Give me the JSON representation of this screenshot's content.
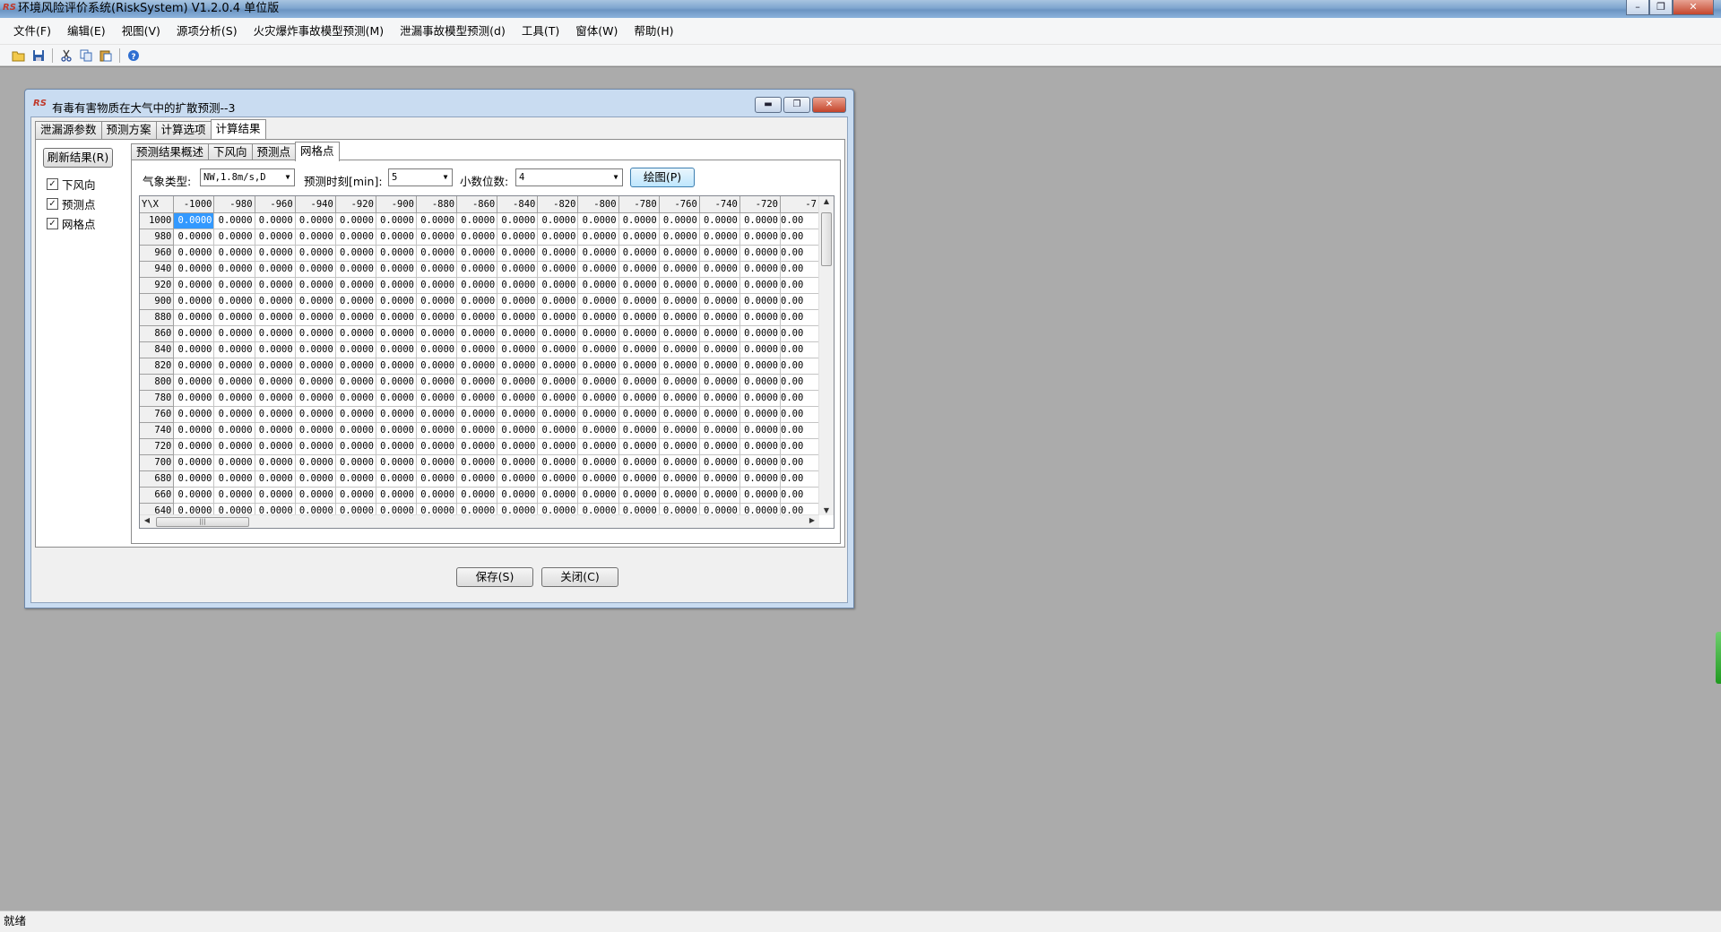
{
  "app": {
    "title": "环境风险评价系统(RiskSystem) V1.2.0.4 单位版",
    "status": "就绪"
  },
  "menu": [
    "文件(F)",
    "编辑(E)",
    "视图(V)",
    "源项分析(S)",
    "火灾爆炸事故模型预测(M)",
    "泄漏事故模型预测(d)",
    "工具(T)",
    "窗体(W)",
    "帮助(H)"
  ],
  "toolbar": {
    "icons": [
      "open-folder-icon",
      "save-icon",
      "cut-icon",
      "copy-icon",
      "paste-icon",
      "help-icon"
    ]
  },
  "dialog": {
    "title": "有毒有害物质在大气中的扩散预测--3",
    "outer_tabs": [
      "泄漏源参数",
      "预测方案",
      "计算选项",
      "计算结果"
    ],
    "active_outer_tab": 3,
    "refresh_button": "刷新结果(R)",
    "checkboxes": [
      {
        "label": "下风向",
        "checked": true
      },
      {
        "label": "预测点",
        "checked": true
      },
      {
        "label": "网格点",
        "checked": true
      }
    ],
    "inner_tabs": [
      "预测结果概述",
      "下风向",
      "预测点",
      "网格点"
    ],
    "active_inner_tab": 3,
    "controls": {
      "weather_label": "气象类型:",
      "weather_value": "NW,1.8m/s,D",
      "time_label": "预测时刻[min]:",
      "time_value": "5",
      "decimal_label": "小数位数:",
      "decimal_value": "4",
      "plot_button": "绘图(P)"
    },
    "grid": {
      "corner": "Y\\X",
      "columns": [
        "-1000",
        "-980",
        "-960",
        "-940",
        "-920",
        "-900",
        "-880",
        "-860",
        "-840",
        "-820",
        "-800",
        "-780",
        "-760",
        "-740",
        "-720",
        "-7"
      ],
      "rows": [
        "1000",
        "980",
        "960",
        "940",
        "920",
        "900",
        "880",
        "860",
        "840",
        "820",
        "800",
        "780",
        "760",
        "740",
        "720",
        "700",
        "680",
        "660",
        "640"
      ],
      "cell_value": "0.0000",
      "last_col_text": "0.00"
    },
    "save_button": "保存(S)",
    "close_button": "关闭(C)"
  }
}
